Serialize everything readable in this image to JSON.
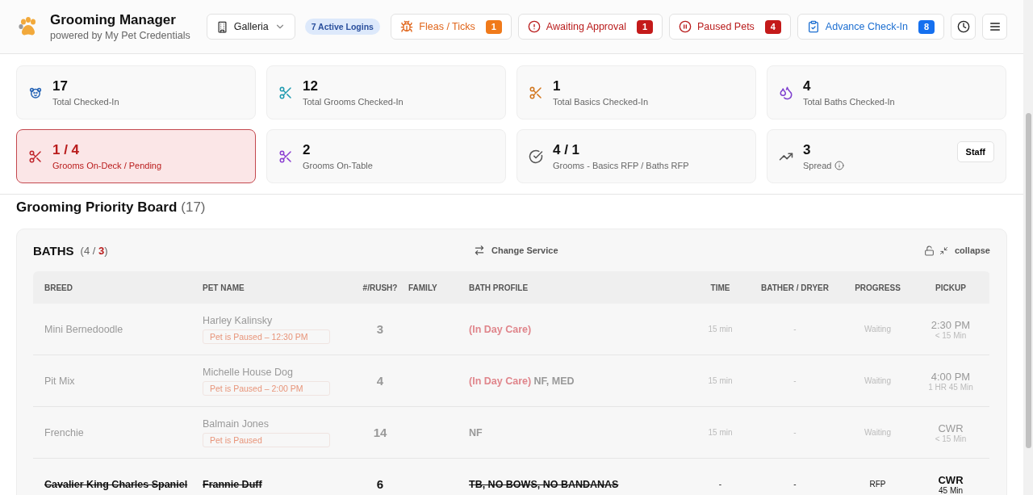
{
  "header": {
    "title": "Grooming Manager",
    "subtitle": "powered by My Pet Credentials",
    "location": "Galleria",
    "active_logins": "7 Active Logins",
    "alerts": [
      {
        "kind": "warning",
        "label": "Fleas / Ticks",
        "count": "1"
      },
      {
        "kind": "danger",
        "label": "Awaiting Approval",
        "count": "1"
      },
      {
        "kind": "paused",
        "label": "Paused Pets",
        "count": "4"
      },
      {
        "kind": "info",
        "label": "Advance Check-In",
        "count": "8"
      }
    ]
  },
  "stats": [
    {
      "value": "17",
      "label": "Total Checked-In",
      "alert": false
    },
    {
      "value": "12",
      "label": "Total Grooms Checked-In",
      "alert": false
    },
    {
      "value": "1",
      "label": "Total Basics Checked-In",
      "alert": false
    },
    {
      "value": "4",
      "label": "Total Baths Checked-In",
      "alert": false
    },
    {
      "value": "1 / 4",
      "label": "Grooms On-Deck / Pending",
      "alert": true
    },
    {
      "value": "2",
      "label": "Grooms On-Table",
      "alert": false
    },
    {
      "value": "4 / 1",
      "label": "Grooms - Basics RFP / Baths RFP",
      "alert": false
    },
    {
      "value": "3",
      "label": "Spread",
      "alert": false,
      "info": true,
      "action": "Staff"
    }
  ],
  "board": {
    "title": "Grooming Priority Board",
    "count": "(17)"
  },
  "baths": {
    "title": "BATHS",
    "count_prefix": "(4 / ",
    "count_over": "3",
    "count_suffix": ")",
    "change_service": "Change Service",
    "collapse": "collapse",
    "columns": [
      "BREED",
      "PET NAME",
      "#/RUSH?",
      "FAMILY",
      "BATH PROFILE",
      "TIME",
      "BATHER / DRYER",
      "PROGRESS",
      "PICKUP"
    ],
    "rows": [
      {
        "breed": "Mini Bernedoodle",
        "pet": "Harley Kalinsky",
        "pause_note": "Pet is Paused – 12:30 PM",
        "rush": "3",
        "daycare": "(In Day Care)",
        "time": "15 min",
        "bather": "-",
        "progress": "Waiting",
        "pickup": "2:30 PM",
        "pickup_sub": "< 15 Min",
        "paused": true,
        "struck": false
      },
      {
        "breed": "Pit Mix",
        "pet": "Michelle House Dog",
        "pause_note": "Pet is Paused – 2:00 PM",
        "rush": "4",
        "daycare": "(In Day Care)",
        "profile": "NF, MED",
        "time": "15 min",
        "bather": "-",
        "progress": "Waiting",
        "pickup": "4:00 PM",
        "pickup_sub": "1 HR 45 Min",
        "paused": true,
        "struck": false
      },
      {
        "breed": "Frenchie",
        "pet": "Balmain Jones",
        "pause_note": "Pet is Paused",
        "rush": "14",
        "profile": "NF",
        "time": "15 min",
        "bather": "-",
        "progress": "Waiting",
        "pickup": "CWR",
        "pickup_sub": "< 15 Min",
        "paused": true,
        "struck": false
      },
      {
        "breed": "Cavalier King Charles Spaniel",
        "pet": "Frannie Duff",
        "rush": "6",
        "profile": "TB, NO BOWS, NO BANDANAS",
        "time": "-",
        "bather": "-",
        "progress": "RFP",
        "pickup": "CWR",
        "pickup_sub": "45 Min",
        "paused": false,
        "struck": true
      }
    ]
  }
}
